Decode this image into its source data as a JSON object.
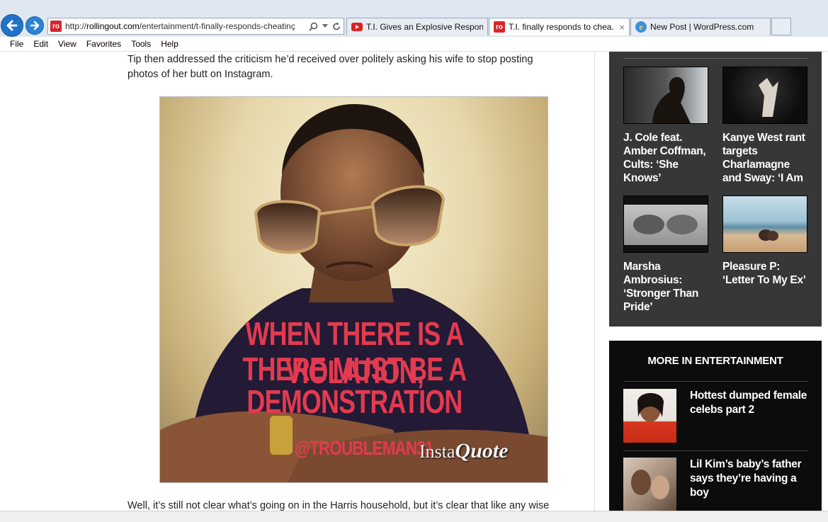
{
  "browser": {
    "url_prefix": "http://",
    "url_domain": "rollingout.com",
    "url_path": "/entertainment/t-finally-responds-cheatinç",
    "favicon_text": "ro",
    "tabs": [
      {
        "label": "T.I. Gives an Explosive Respons...",
        "icon": "youtube-icon",
        "active": false
      },
      {
        "label": "T.I. finally responds to chea...",
        "icon": "rollingout-icon",
        "active": true,
        "close": "×"
      },
      {
        "label": "New Post | WordPress.com",
        "icon": "ie-icon",
        "active": false
      }
    ],
    "menu": [
      "File",
      "Edit",
      "View",
      "Favorites",
      "Tools",
      "Help"
    ]
  },
  "article": {
    "para_1": "Tip then addressed the criticism he’d received over politely asking his wife to stop posting photos of her butt on Instagram.",
    "para_2": "Well, it’s still not clear what’s going on in the Harris household, but it’s clear that like any wise",
    "image": {
      "quote_line_1": "WHEN THERE IS A VIOLATION,",
      "quote_line_2": "THERE MUST BE A",
      "quote_line_3": "DEMONSTRATION",
      "handle": "@TROUBLEMAN31",
      "brand_a": "Insta",
      "brand_b": "Quote"
    }
  },
  "sidebar": {
    "videos": [
      {
        "title": "J. Cole feat. Amber Coffman, Cults: ‘She Knows’"
      },
      {
        "title": "Kanye West rant targets Charlamagne and Sway: ‘I Am"
      },
      {
        "title": "Marsha Ambrosius: ‘Stronger Than Pride’"
      },
      {
        "title": "Pleasure P: ‘Letter To My Ex’"
      }
    ],
    "more_heading": "MORE IN ENTERTAINMENT",
    "more_items": [
      {
        "title": "Hottest dumped female celebs part 2"
      },
      {
        "title": "Lil Kim’s baby’s father says they’re having a boy"
      }
    ]
  },
  "colors": {
    "accent_red": "#d8252c",
    "quote_pink": "#e33a4f",
    "sidebar_dark": "#373737",
    "sidebar_black": "#0c0c0c"
  }
}
